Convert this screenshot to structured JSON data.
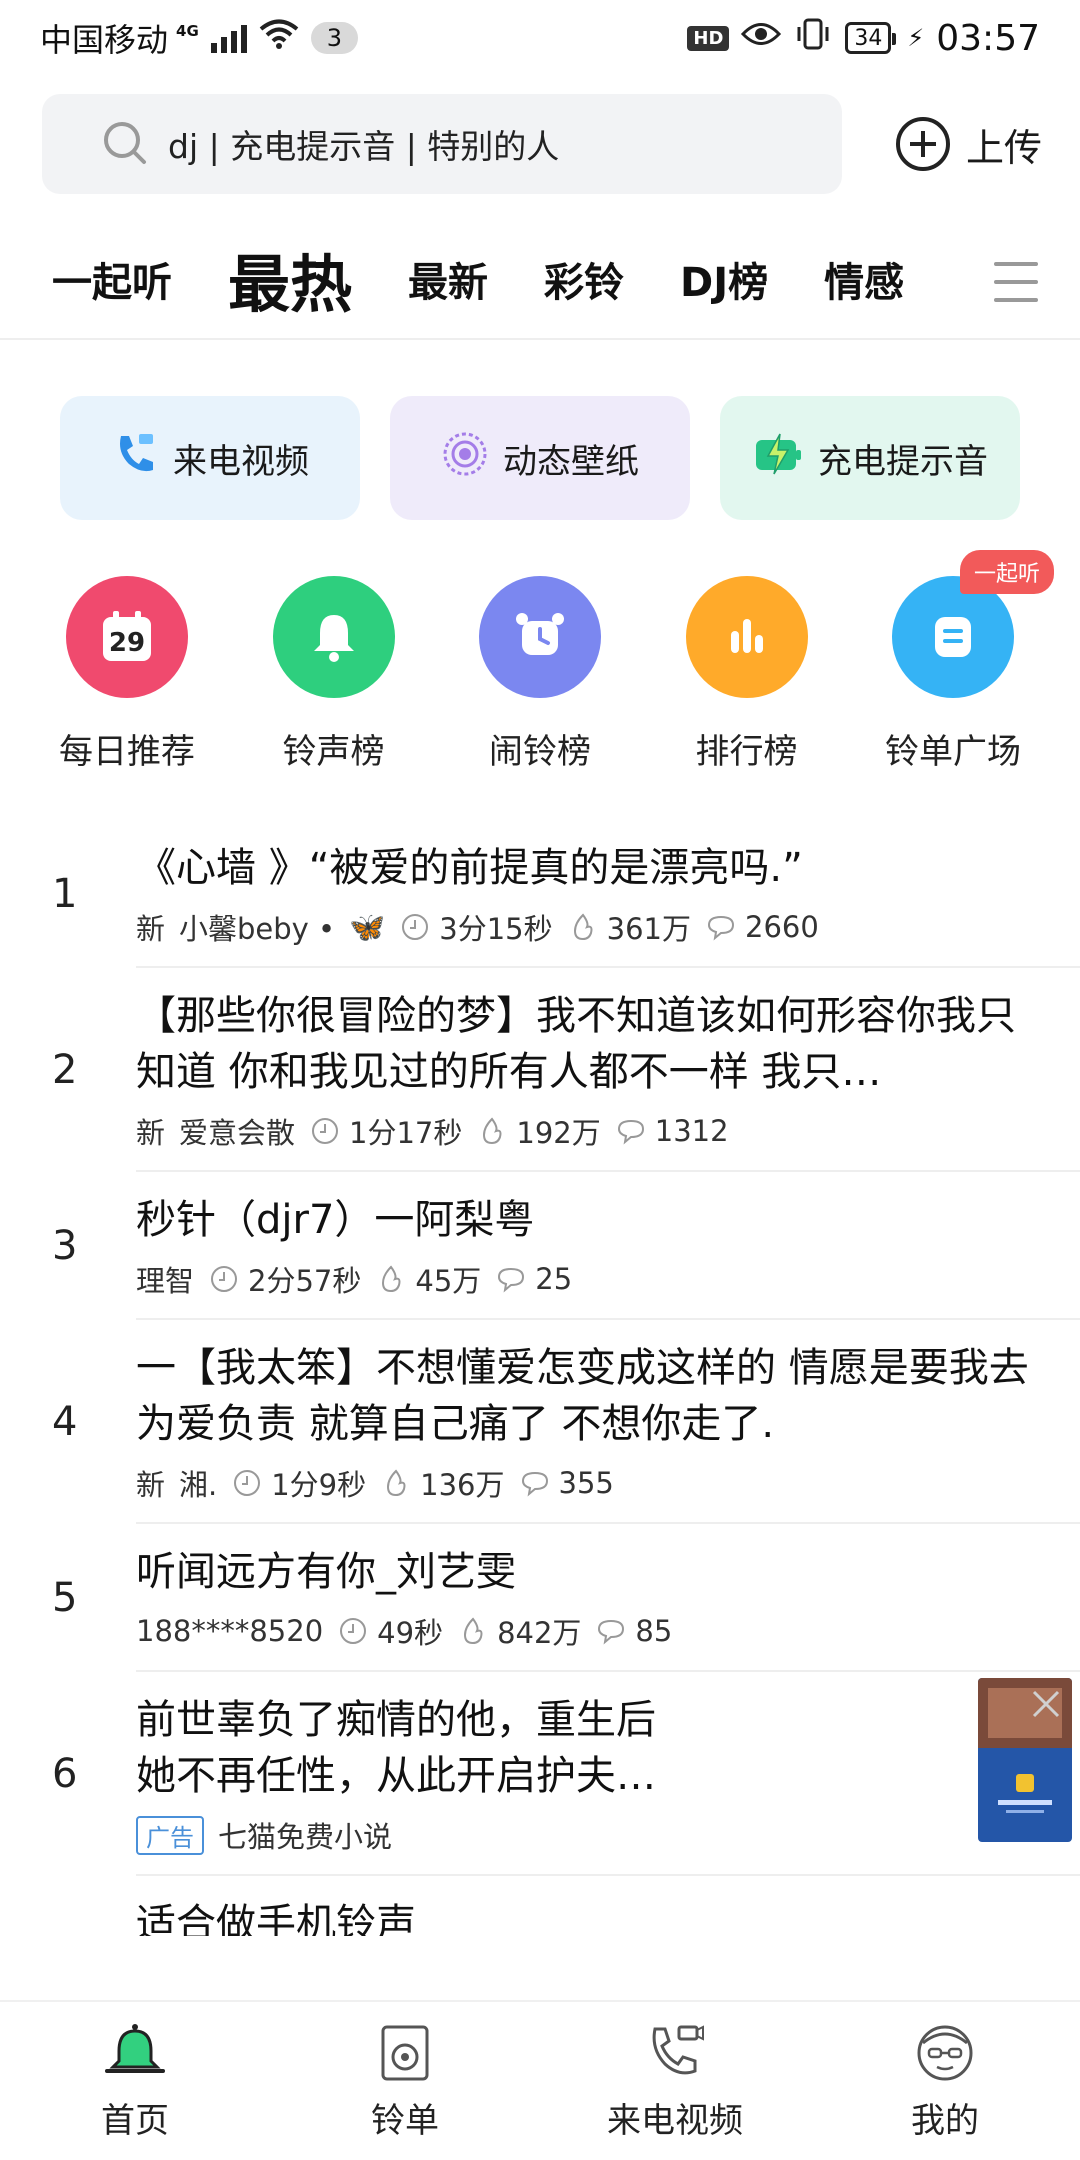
{
  "status_bar": {
    "carrier": "中国移动",
    "network": "4G",
    "notification_count": "3",
    "hd": "HD",
    "battery": "34",
    "time": "03:57"
  },
  "search": {
    "query": "dj | 充电提示音 | 特别的人",
    "upload_label": "上传"
  },
  "tabs": [
    {
      "label": "一起听",
      "active": false
    },
    {
      "label": "最热",
      "active": true
    },
    {
      "label": "最新",
      "active": false
    },
    {
      "label": "彩铃",
      "active": false
    },
    {
      "label": "DJ榜",
      "active": false
    },
    {
      "label": "情感",
      "active": false
    }
  ],
  "features": [
    {
      "label": "来电视频",
      "icon": "phone-video-icon"
    },
    {
      "label": "动态壁纸",
      "icon": "wallpaper-icon"
    },
    {
      "label": "充电提示音",
      "icon": "charging-icon"
    }
  ],
  "shortcuts": [
    {
      "label": "每日推荐",
      "icon": "calendar-icon",
      "day": "29",
      "color": "#f04a6e"
    },
    {
      "label": "铃声榜",
      "icon": "bell-icon",
      "color": "#2ecf7e"
    },
    {
      "label": "闹铃榜",
      "icon": "alarm-clock-icon",
      "color": "#7b87f0"
    },
    {
      "label": "排行榜",
      "icon": "bar-chart-icon",
      "color": "#ffaa2a"
    },
    {
      "label": "铃单广场",
      "icon": "playlist-icon",
      "color": "#35b3f5",
      "badge": "一起听"
    }
  ],
  "list": [
    {
      "rank": "1",
      "title": "《心墙 》“被爱的前提真的是漂亮吗.”",
      "new": "新",
      "author": "小馨beby •",
      "author_badge": "🦋",
      "duration": "3分15秒",
      "plays": "361万",
      "comments": "2660"
    },
    {
      "rank": "2",
      "title": "【那些你很冒险的梦】我不知道该如何形容你我只知道 你和我见过的所有人都不一样 我只…",
      "new": "新",
      "author": "爱意会散",
      "duration": "1分17秒",
      "plays": "192万",
      "comments": "1312"
    },
    {
      "rank": "3",
      "title": "秒针（djr7）一阿梨粤",
      "new": "",
      "author": "理智",
      "duration": "2分57秒",
      "plays": "45万",
      "comments": "25"
    },
    {
      "rank": "4",
      "title": "一【我太笨】不想懂爱怎变成这样的 情愿是要我去为爱负责 就算自己痛了 不想你走了.",
      "new": "新",
      "author": "湘.",
      "duration": "1分9秒",
      "plays": "136万",
      "comments": "355"
    },
    {
      "rank": "5",
      "title": "听闻远方有你_刘艺雯",
      "new": "",
      "author": "188****8520",
      "duration": "49秒",
      "plays": "842万",
      "comments": "85"
    }
  ],
  "ad": {
    "rank": "6",
    "title_line1": "前世辜负了痴情的他，重生后",
    "title_line2": "她不再任性，从此开启护夫…",
    "tag": "广告",
    "advertiser": "七猫免费小说"
  },
  "partial_next_title": "适合做手机铃声",
  "bottom_nav": [
    {
      "label": "首页",
      "icon": "bell-home-icon",
      "active": true
    },
    {
      "label": "铃单",
      "icon": "playlist-disc-icon",
      "active": false
    },
    {
      "label": "来电视频",
      "icon": "phone-video-icon",
      "active": false
    },
    {
      "label": "我的",
      "icon": "profile-avatar-icon",
      "active": false
    }
  ],
  "colors": {
    "accent_green": "#2ecf7e",
    "ad_blue": "#4a90d9",
    "badge_red": "#f25a5a"
  }
}
